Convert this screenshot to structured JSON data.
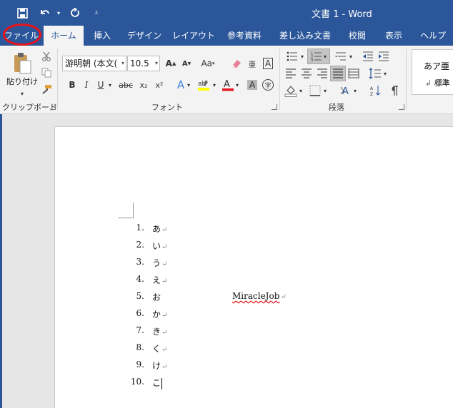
{
  "window": {
    "title": "文書 1 - Word"
  },
  "qat": {
    "save_icon": "save-icon",
    "undo_icon": "undo-icon",
    "redo_icon": "redo-icon",
    "customize_icon": "customize-icon"
  },
  "tabs": [
    {
      "label": "ファイル"
    },
    {
      "label": "ホーム"
    },
    {
      "label": "挿入"
    },
    {
      "label": "デザイン"
    },
    {
      "label": "レイアウト"
    },
    {
      "label": "参考資料"
    },
    {
      "label": "差し込み文書"
    },
    {
      "label": "校閲"
    },
    {
      "label": "表示"
    },
    {
      "label": "ヘルプ"
    }
  ],
  "ribbon": {
    "clipboard": {
      "paste_label": "貼り付け",
      "group_label": "クリップボード"
    },
    "font": {
      "font_name": "游明朝 (本文(",
      "font_size": "10.5",
      "bold": "B",
      "italic": "I",
      "underline": "U",
      "strike": "abc",
      "sub": "x₂",
      "sup": "x²",
      "aa": "Aa",
      "group_label": "フォント"
    },
    "paragraph": {
      "group_label": "段落"
    },
    "styles": {
      "sample": "あア亜",
      "style_name": "標準"
    }
  },
  "document": {
    "items": [
      {
        "num": "1.",
        "text": "あ"
      },
      {
        "num": "2.",
        "text": "い"
      },
      {
        "num": "3.",
        "text": "う"
      },
      {
        "num": "4.",
        "text": "え"
      },
      {
        "num": "5.",
        "text": "お"
      },
      {
        "num": "6.",
        "text": "か"
      },
      {
        "num": "7.",
        "text": "き"
      },
      {
        "num": "8.",
        "text": "く"
      },
      {
        "num": "9.",
        "text": "け"
      },
      {
        "num": "10.",
        "text": "こ"
      }
    ],
    "mj_text": "MiracleJob",
    "para_mark": "↵"
  },
  "colors": {
    "accent": "#2b579a",
    "highlight_circle": "#e8141c"
  }
}
